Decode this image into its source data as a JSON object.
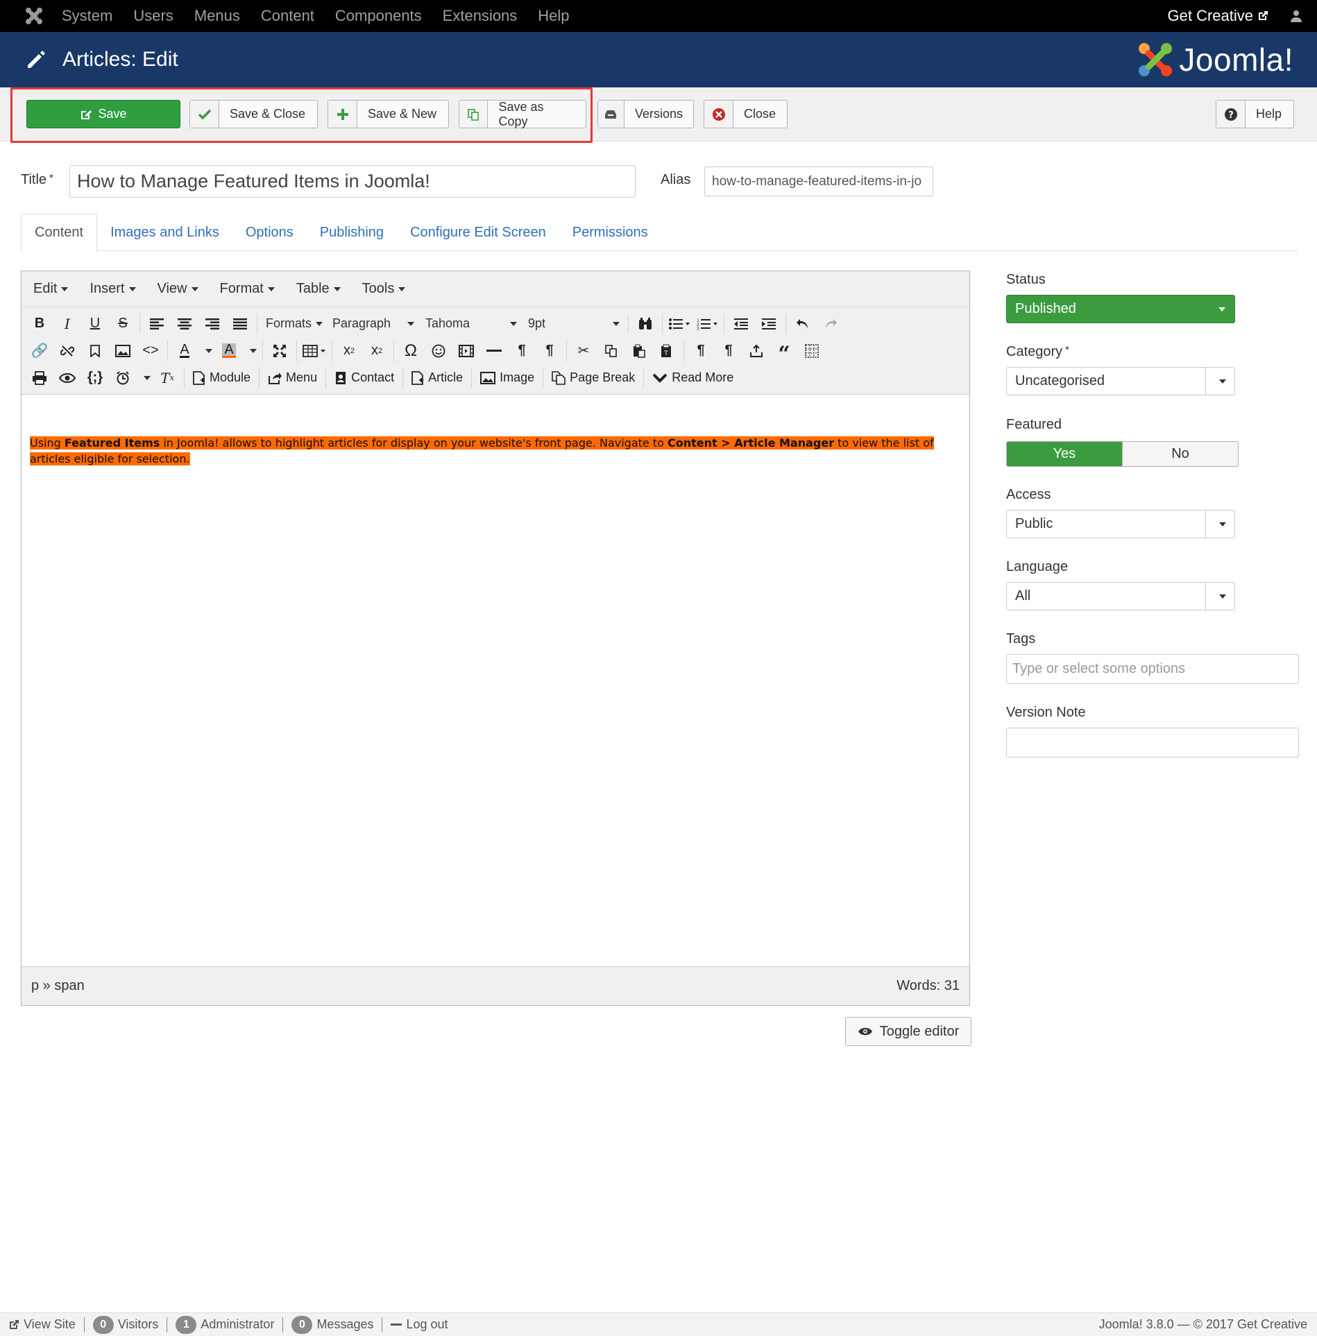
{
  "topnav": {
    "items": [
      "System",
      "Users",
      "Menus",
      "Content",
      "Components",
      "Extensions",
      "Help"
    ],
    "get_creative": "Get Creative"
  },
  "header": {
    "title": "Articles: Edit",
    "brand": "Joomla!"
  },
  "toolbar": {
    "save": "Save",
    "save_close": "Save & Close",
    "save_new": "Save & New",
    "save_copy": "Save as Copy",
    "versions": "Versions",
    "close": "Close",
    "help": "Help"
  },
  "form": {
    "title_label": "Title",
    "title_value": "How to Manage Featured Items in Joomla!",
    "alias_label": "Alias",
    "alias_value": "how-to-manage-featured-items-in-jo",
    "required_mark": "*"
  },
  "tabs": [
    "Content",
    "Images and Links",
    "Options",
    "Publishing",
    "Configure Edit Screen",
    "Permissions"
  ],
  "editor": {
    "menus": [
      "Edit",
      "Insert",
      "View",
      "Format",
      "Table",
      "Tools"
    ],
    "formats": "Formats",
    "paragraph": "Paragraph",
    "font": "Tahoma",
    "size": "9pt",
    "buttons": {
      "module": "Module",
      "menu": "Menu",
      "contact": "Contact",
      "article": "Article",
      "image": "Image",
      "page_break": "Page Break",
      "read_more": "Read More"
    },
    "content": {
      "p1": "Using ",
      "b1": "Featured Items",
      "p2": " in Joomla! allows to highlight articles for display on your website's front page. Navigate to ",
      "b2": "Content > Article Manager",
      "p3": " to view the list of articles eligible for selection."
    },
    "path": "p » span",
    "words": "Words: 31",
    "toggle": "Toggle editor"
  },
  "sidebar": {
    "status_label": "Status",
    "status_value": "Published",
    "category_label": "Category",
    "category_value": "Uncategorised",
    "featured_label": "Featured",
    "featured_yes": "Yes",
    "featured_no": "No",
    "access_label": "Access",
    "access_value": "Public",
    "language_label": "Language",
    "language_value": "All",
    "tags_label": "Tags",
    "tags_placeholder": "Type or select some options",
    "version_label": "Version Note"
  },
  "footer": {
    "view_site": "View Site",
    "visitors_count": "0",
    "visitors": "Visitors",
    "admin_count": "1",
    "admin": "Administrator",
    "messages_count": "0",
    "messages": "Messages",
    "logout": "Log out",
    "version": "Joomla! 3.8.0 — © 2017 Get Creative"
  },
  "colors": {
    "header_bg": "#1a3867",
    "save_green": "#2f9e3f",
    "highlight": "#ff6a00",
    "annotation_red": "#e53935"
  }
}
